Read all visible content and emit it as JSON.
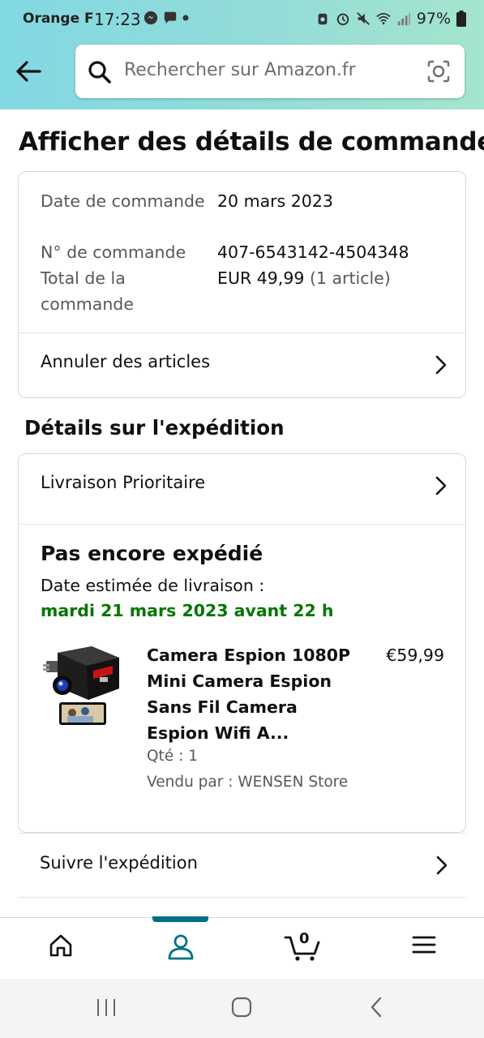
{
  "status_bar": {
    "carrier": "Orange F",
    "time": "17:23",
    "battery": "97%",
    "icons": [
      "messenger-icon",
      "chat-icon",
      "dot-icon",
      "alarm-icon",
      "clock-icon",
      "mute-icon",
      "wifi-icon",
      "signal-icon",
      "battery-icon"
    ]
  },
  "header": {
    "search_placeholder": "Rechercher sur Amazon.fr",
    "back_icon": "arrow-left-icon",
    "search_icon": "search-icon",
    "lens_icon": "camera-lens-icon"
  },
  "page": {
    "title": "Afficher des détails de commande"
  },
  "order_summary": {
    "date_label": "Date de commande",
    "date_value": "20 mars 2023",
    "number_label": "N° de commande",
    "number_value": "407-6543142-4504348",
    "total_label": "Total de la commande",
    "total_value": "EUR 49,99",
    "total_items": "(1 article)",
    "cancel_label": "Annuler des articles"
  },
  "shipment": {
    "heading": "Détails sur l'expédition",
    "delivery_type": "Livraison Prioritaire",
    "status": "Pas encore expédié",
    "eta_label": "Date estimée de livraison :",
    "eta_value": "mardi 21 mars 2023 avant 22 h",
    "product": {
      "name": "Camera Espion 1080P Mini Camera Espion Sans Fil Camera Espion Wifi A...",
      "price": "€59,99",
      "qty": "Qté : 1",
      "seller": "Vendu par : WENSEN Store"
    },
    "track_label": "Suivre l'expédition"
  },
  "tabbar": {
    "tabs": [
      "home-icon",
      "account-icon",
      "cart-icon",
      "menu-icon"
    ],
    "active": "account-icon",
    "cart_count": "0",
    "accent": "#007185"
  },
  "colors": {
    "eta_green": "#007600",
    "header_gradient_start": "#82d8e3",
    "header_gradient_end": "#a5e5cd"
  }
}
